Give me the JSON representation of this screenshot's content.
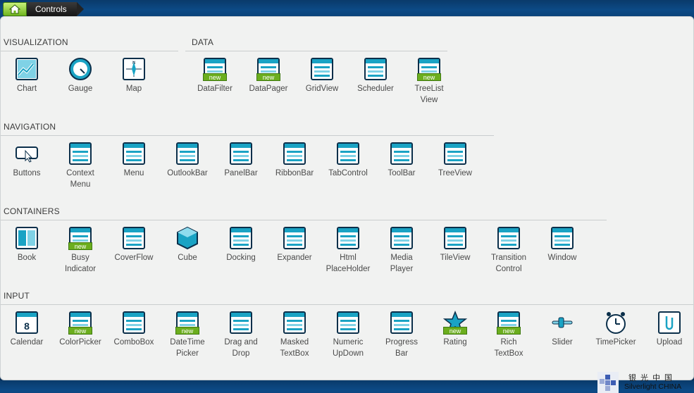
{
  "breadcrumb": {
    "home_icon": "home-icon",
    "label": "Controls"
  },
  "sections": {
    "visualization": "VISUALIZATION",
    "data": "DATA",
    "navigation": "NAVIGATION",
    "containers": "CONTAINERS",
    "input": "INPUT"
  },
  "new_badge": "new",
  "visualization": [
    {
      "label": "Chart"
    },
    {
      "label": "Gauge"
    },
    {
      "label": "Map"
    }
  ],
  "data": [
    {
      "label": "DataFilter",
      "new": true
    },
    {
      "label": "DataPager",
      "new": true
    },
    {
      "label": "GridView"
    },
    {
      "label": "Scheduler"
    },
    {
      "label": "TreeList\nView",
      "new": true
    }
  ],
  "navigation": [
    {
      "label": "Buttons"
    },
    {
      "label": "Context\nMenu"
    },
    {
      "label": "Menu"
    },
    {
      "label": "OutlookBar"
    },
    {
      "label": "PanelBar"
    },
    {
      "label": "RibbonBar"
    },
    {
      "label": "TabControl"
    },
    {
      "label": "ToolBar"
    },
    {
      "label": "TreeView"
    }
  ],
  "containers": [
    {
      "label": "Book"
    },
    {
      "label": "Busy\nIndicator",
      "new": true
    },
    {
      "label": "CoverFlow"
    },
    {
      "label": "Cube"
    },
    {
      "label": "Docking"
    },
    {
      "label": "Expander"
    },
    {
      "label": "Html\nPlaceHolder"
    },
    {
      "label": "Media\nPlayer"
    },
    {
      "label": "TileView"
    },
    {
      "label": "Transition\nControl"
    },
    {
      "label": "Window"
    }
  ],
  "input": [
    {
      "label": "Calendar"
    },
    {
      "label": "ColorPicker",
      "new": true
    },
    {
      "label": "ComboBox"
    },
    {
      "label": "DateTime\nPicker",
      "new": true
    },
    {
      "label": "Drag and\nDrop"
    },
    {
      "label": "Masked\nTextBox"
    },
    {
      "label": "Numeric\nUpDown"
    },
    {
      "label": "Progress\nBar"
    },
    {
      "label": "Rating",
      "new": true
    },
    {
      "label": "Rich\nTextBox",
      "new": true
    },
    {
      "label": "Slider"
    },
    {
      "label": "TimePicker"
    },
    {
      "label": "Upload"
    }
  ],
  "watermark": {
    "cn": "银光中国",
    "en": "Silverlight CHINA"
  },
  "colors": {
    "accent": "#1aa3c4",
    "dark": "#0b2f4a",
    "badge": "#6cae1e"
  }
}
